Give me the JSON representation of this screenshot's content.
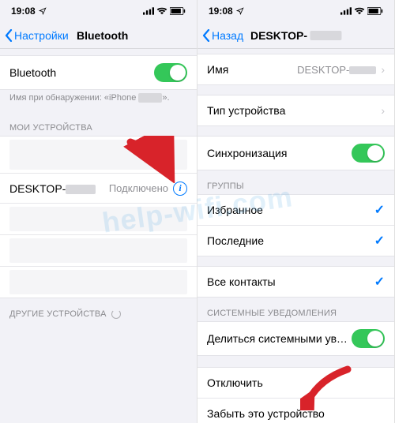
{
  "status": {
    "time": "19:08"
  },
  "left": {
    "back": "Настройки",
    "title": "Bluetooth",
    "bluetooth_label": "Bluetooth",
    "footer_discover": "Имя при обнаружении: «iPhone",
    "section_my": "МОИ УСТРОЙСТВА",
    "device_name_prefix": "DESKTOP-",
    "device_status": "Подключено",
    "section_other": "ДРУГИЕ УСТРОЙСТВА"
  },
  "right": {
    "back": "Назад",
    "title_prefix": "DESKTOP-",
    "name_label": "Имя",
    "name_value_prefix": "DESKTOP-",
    "type_label": "Тип устройства",
    "sync_label": "Синхронизация",
    "section_groups": "ГРУППЫ",
    "favorites": "Избранное",
    "recents": "Последние",
    "all_contacts": "Все контакты",
    "section_sysnotif": "СИСТЕМНЫЕ УВЕДОМЛЕНИЯ",
    "share_sys": "Делиться системными уведо…",
    "disconnect": "Отключить",
    "forget": "Забыть это устройство"
  },
  "watermark": "help-wifi.com"
}
